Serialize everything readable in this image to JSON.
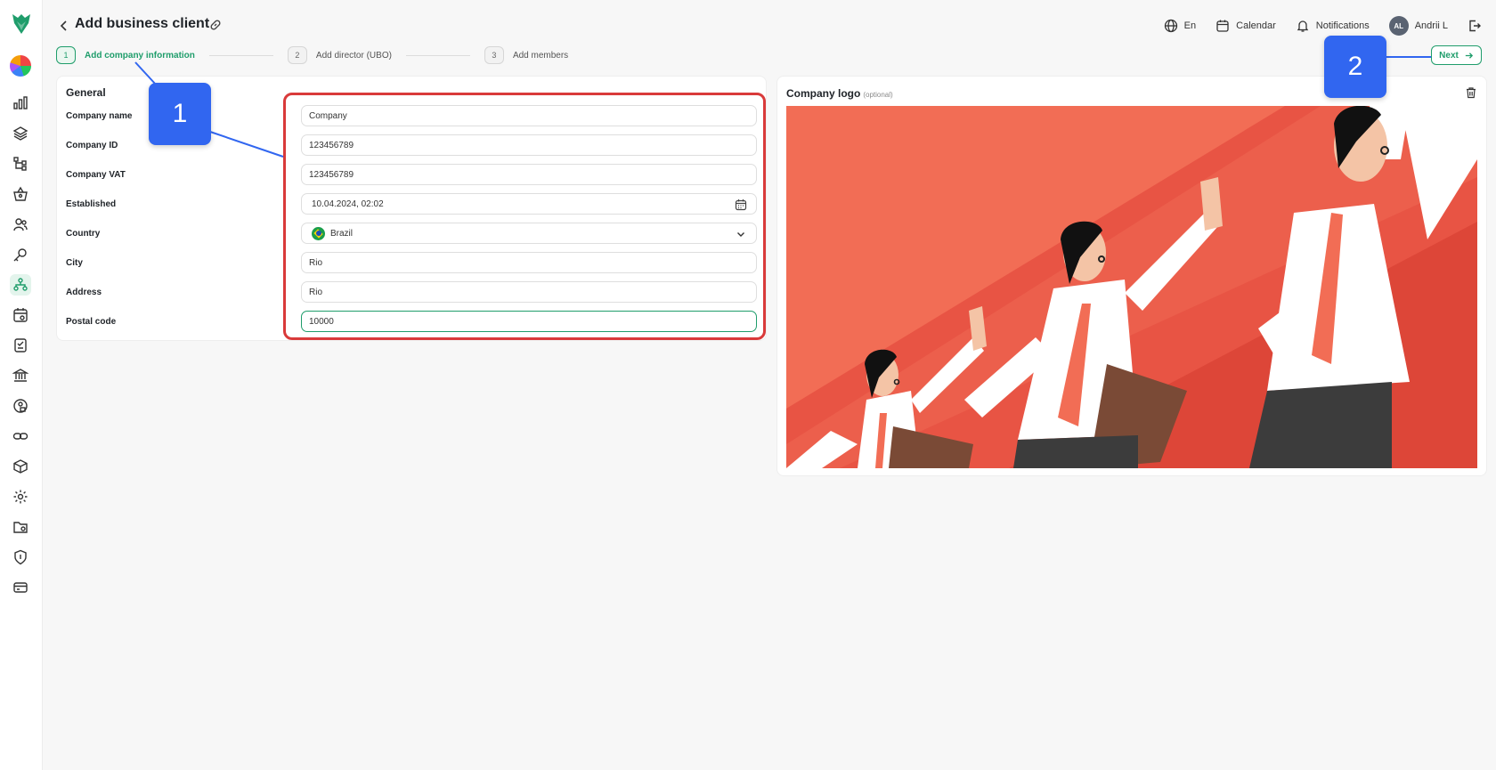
{
  "header": {
    "title": "Add business client",
    "language": "En",
    "calendar": "Calendar",
    "notifications": "Notifications",
    "user_initials": "AL",
    "user_name": "Andrii L"
  },
  "stepper": {
    "steps": [
      {
        "num": "1",
        "label": "Add company information"
      },
      {
        "num": "2",
        "label": "Add director (UBO)"
      },
      {
        "num": "3",
        "label": "Add members"
      }
    ],
    "next_label": "Next"
  },
  "general": {
    "title": "General",
    "fields": [
      {
        "label": "Company name",
        "value": "Company"
      },
      {
        "label": "Company ID",
        "value": "123456789"
      },
      {
        "label": "Company VAT",
        "value": "123456789"
      },
      {
        "label": "Established",
        "value": "10.04.2024, 02:02"
      },
      {
        "label": "Country",
        "value": "Brazil"
      },
      {
        "label": "City",
        "value": "Rio"
      },
      {
        "label": "Address",
        "value": "Rio"
      },
      {
        "label": "Postal code",
        "value": "10000"
      }
    ]
  },
  "logo": {
    "title": "Company logo",
    "optional": "(optional)"
  },
  "callouts": [
    "1",
    "2"
  ],
  "colors": {
    "accent": "#1f9d6b",
    "highlight": "#d93a3a",
    "callout": "#3166f0",
    "illustration_bg": "#e85444"
  },
  "sidebar": {
    "icons": [
      "analytics-icon",
      "layers-icon",
      "hierarchy-icon",
      "basket-icon",
      "users-icon",
      "key-icon",
      "network-icon",
      "calendar-settings-icon",
      "checklist-icon",
      "bank-icon",
      "user-lock-icon",
      "link-icon",
      "box-icon",
      "settings-icon",
      "folder-icon",
      "shield-icon",
      "card-icon"
    ]
  }
}
